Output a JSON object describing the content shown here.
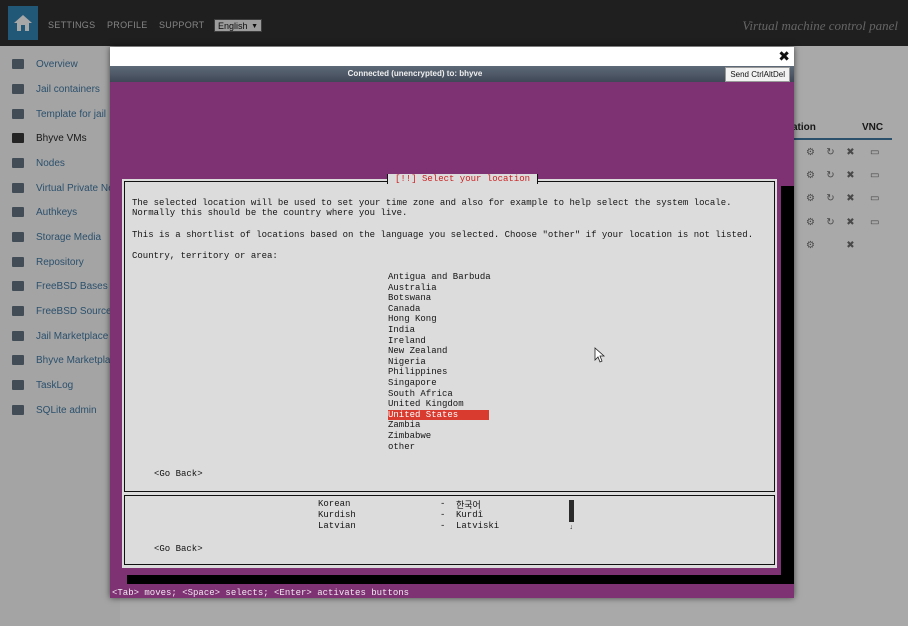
{
  "topbar": {
    "nav": [
      "SETTINGS",
      "PROFILE",
      "SUPPORT"
    ],
    "language": "English",
    "panel_title": "Virtual machine control panel"
  },
  "sidebar": {
    "items": [
      {
        "label": "Overview",
        "icon": "bar-chart-icon"
      },
      {
        "label": "Jail containers",
        "icon": "server-icon"
      },
      {
        "label": "Template for jail",
        "icon": "cogs-icon"
      },
      {
        "label": "Bhyve VMs",
        "icon": "list-icon",
        "active": true
      },
      {
        "label": "Nodes",
        "icon": "stack-icon"
      },
      {
        "label": "Virtual Private Network",
        "icon": "plane-icon"
      },
      {
        "label": "Authkeys",
        "icon": "key-icon"
      },
      {
        "label": "Storage Media",
        "icon": "drive-icon"
      },
      {
        "label": "Repository",
        "icon": "globe-icon"
      },
      {
        "label": "FreeBSD Bases",
        "icon": "database-icon"
      },
      {
        "label": "FreeBSD Sources",
        "icon": "edit-icon"
      },
      {
        "label": "Jail Marketplace",
        "icon": "flag-icon"
      },
      {
        "label": "Bhyve Marketplace",
        "icon": "random-icon"
      },
      {
        "label": "TaskLog",
        "icon": "tasklist-icon"
      },
      {
        "label": "SQLite admin",
        "icon": "sqlite-icon"
      }
    ]
  },
  "bg_table": {
    "headers": [
      "ation",
      "VNC"
    ]
  },
  "modal": {
    "close_glyph": "✖",
    "status": "Connected (unencrypted) to: bhyve",
    "send_button": "Send CtrlAltDel"
  },
  "terminal": {
    "title": "[!!] Select your location",
    "lines": [
      "The selected location will be used to set your time zone and also for example to help select the system locale.",
      "Normally this should be the country where you live.",
      "This is a shortlist of locations based on the language you selected. Choose \"other\" if your location is not listed.",
      "Country, territory or area:"
    ],
    "locations": [
      "Antigua and Barbuda",
      "Australia",
      "Botswana",
      "Canada",
      "Hong Kong",
      "India",
      "Ireland",
      "New Zealand",
      "Nigeria",
      "Philippines",
      "Singapore",
      "South Africa",
      "United Kingdom",
      "United States",
      "Zambia",
      "Zimbabwe",
      "other"
    ],
    "selected_location": "United States",
    "go_back": "<Go Back>",
    "languages": [
      {
        "name": "Korean",
        "dash": "-",
        "native": "한국어"
      },
      {
        "name": "Kurdish",
        "dash": "-",
        "native": "Kurdî"
      },
      {
        "name": "Latvian",
        "dash": "-",
        "native": "Latviski"
      }
    ],
    "scroll_arrow": "↓",
    "help": "<Tab> moves; <Space> selects; <Enter> activates buttons"
  }
}
